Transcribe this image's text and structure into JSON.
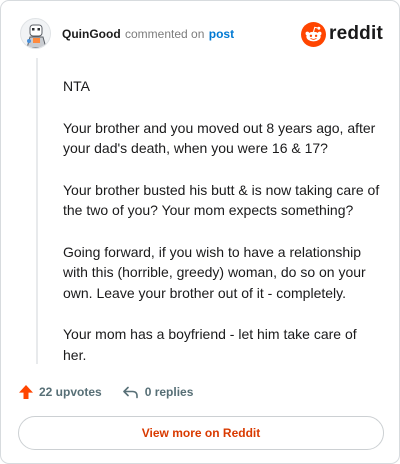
{
  "header": {
    "username": "QuinGood",
    "commented_text": "commented on",
    "post_link": "post",
    "brand_name": "reddit"
  },
  "comment": {
    "paragraphs": [
      "NTA",
      "Your brother and you moved out 8 years ago, after your dad's death, when you were 16 & 17?",
      "Your brother busted his butt & is now taking care of the two of you? Your mom expects something?",
      "Going forward, if you wish to have a relationship with this (horrible, greedy) woman, do so on your own. Leave your brother out of it - completely.",
      "Your mom has a boyfriend - let him take care of her."
    ]
  },
  "actions": {
    "upvotes_label": "22 upvotes",
    "replies_label": "0 replies"
  },
  "footer": {
    "view_more_label": "View more on Reddit"
  },
  "icons": {
    "avatar": "user-avatar-icon",
    "brand": "reddit-logo-icon",
    "upvote": "upvote-arrow-icon",
    "reply": "reply-arrow-icon"
  },
  "colors": {
    "brand": "#ff4500",
    "link": "#0079d3",
    "upvote": "#ff4500",
    "view_more_text": "#d93a00",
    "muted": "#576f76"
  }
}
